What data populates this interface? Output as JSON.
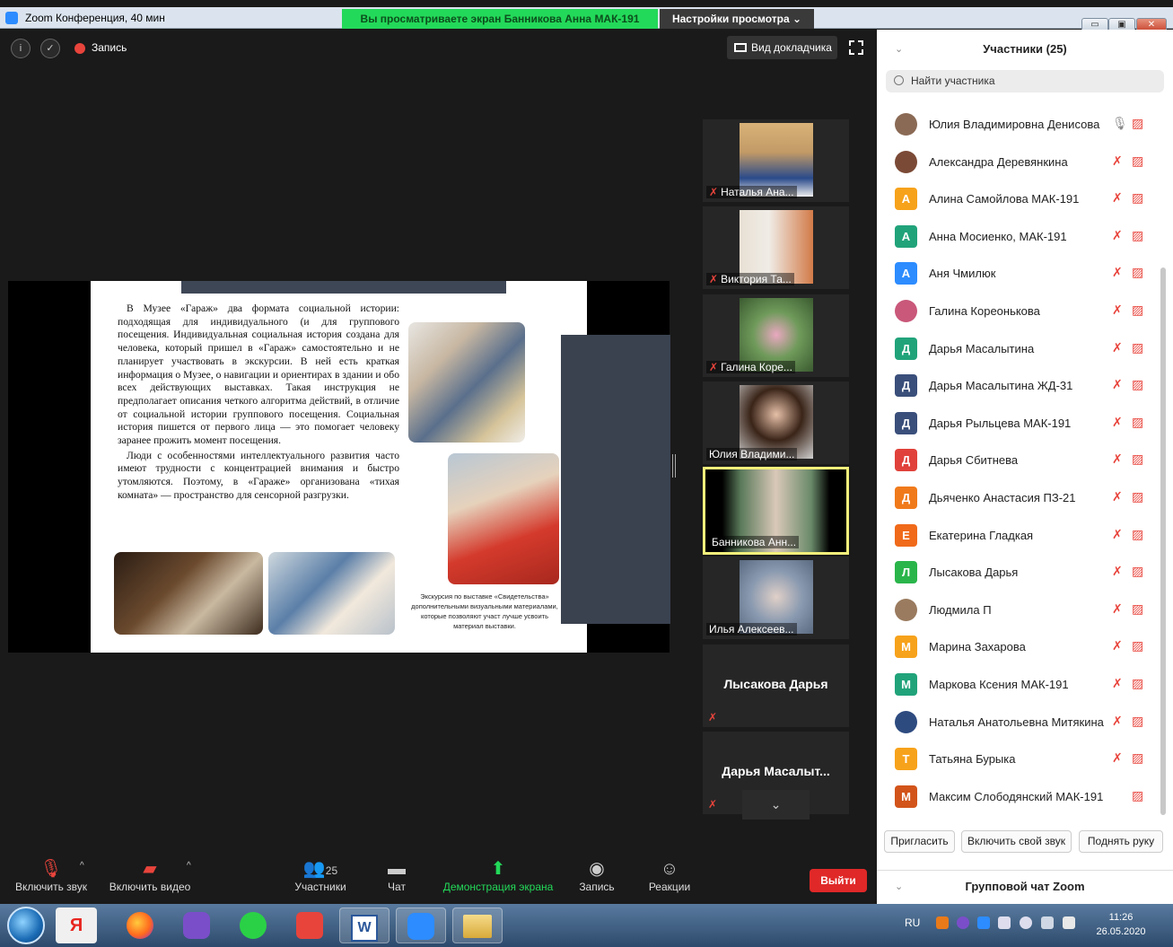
{
  "titlebar": {
    "title": "Zoom Конференция, 40 мин",
    "share_banner": "Вы просматриваете экран  Банникова Анна МАК-191",
    "view_options": "Настройки просмотра ⌄",
    "min": "▭",
    "max": "▣",
    "close": "✕"
  },
  "meeting": {
    "recording_label": "Запись",
    "speaker_view_label": "Вид докладчика"
  },
  "slide": {
    "paragraph1": "В Музее «Гараж» два формата социальной истории: подходящая для индивидуального (и для группового посещения. Индивидуальная социальная история создана для человека, который пришел в «Гараж» самостоятельно и не планирует участвовать в экскурсии. В ней есть краткая информация о Музее, о навигации и ориентирах в здании и обо всех действующих выставках. Такая инструкция не предполагает описания четкого алгоритма действий, в отличие от социальной истории группового посещения. Социальная история пишется от первого лица — это помогает человеку заранее прожить момент посещения.",
    "paragraph2": "Люди с особенностями интеллектуального развития часто имеют трудности с концентрацией внимания и быстро утомляются. Поэтому, в «Гараже» организована «тихая комната» — пространство для сенсорной разгрузки.",
    "caption": "Экскурсия по выставке «Свидетельства» дополнительными визуальными материалами, которые позволяют участ лучше усвоить материал выставки."
  },
  "thumbnails": [
    {
      "name": "Наталья Ана...",
      "muted": true
    },
    {
      "name": "Виктория Та...",
      "muted": true
    },
    {
      "name": "Галина Коре...",
      "muted": true
    },
    {
      "name": "Юлия Владими...",
      "muted": false
    },
    {
      "name": "Банникова Анн...",
      "muted": false,
      "active": true
    },
    {
      "name": "Илья Алексеев...",
      "muted": false
    },
    {
      "name": "Лысакова Дарья",
      "muted": true
    },
    {
      "name": "Дарья  Масалыт...",
      "muted": true
    }
  ],
  "toolbar": {
    "unmute": "Включить звук",
    "start_video": "Включить видео",
    "participants": "Участники",
    "participants_count": "25",
    "chat": "Чат",
    "share_screen": "Демонстрация экрана",
    "record": "Запись",
    "reactions": "Реакции",
    "leave": "Выйти"
  },
  "panel": {
    "title": "Участники (25)",
    "search_placeholder": "Найти участника",
    "invite": "Пригласить",
    "unmute_me": "Включить свой звук",
    "raise_hand": "Поднять руку",
    "chat_title": "Групповой чат Zoom",
    "participants": [
      {
        "name": "Юлия Владимировна Денисова",
        "initial": "",
        "color": "#8a6a55",
        "mic": "on"
      },
      {
        "name": "Александра Деревянкина",
        "initial": "",
        "color": "#7b4a36",
        "mic": "off"
      },
      {
        "name": "Алина Самойлова МАК-191",
        "initial": "А",
        "color": "#f7a21b",
        "mic": "off"
      },
      {
        "name": "Анна Мосиенко, МАК-191",
        "initial": "А",
        "color": "#21a37a",
        "mic": "off"
      },
      {
        "name": "Аня Чмилюк",
        "initial": "А",
        "color": "#2d8cff",
        "mic": "off"
      },
      {
        "name": "Галина Кореонькова",
        "initial": "",
        "color": "#c9587a",
        "mic": "off"
      },
      {
        "name": "Дарья Масалытина",
        "initial": "Д",
        "color": "#21a37a",
        "mic": "off"
      },
      {
        "name": "Дарья Масалытина ЖД-31",
        "initial": "Д",
        "color": "#3a4f7a",
        "mic": "off"
      },
      {
        "name": "Дарья Рыльцева МАК-191",
        "initial": "Д",
        "color": "#3a4f7a",
        "mic": "off"
      },
      {
        "name": "Дарья Сбитнева",
        "initial": "Д",
        "color": "#e0413a",
        "mic": "off"
      },
      {
        "name": "Дьяченко Анастасия ПЗ-21",
        "initial": "Д",
        "color": "#f07a1a",
        "mic": "off"
      },
      {
        "name": "Екатерина Гладкая",
        "initial": "Е",
        "color": "#f06a1a",
        "mic": "off"
      },
      {
        "name": "Лысакова Дарья",
        "initial": "Л",
        "color": "#2ab54a",
        "mic": "off"
      },
      {
        "name": "Людмила П",
        "initial": "",
        "color": "#9a7b5f",
        "mic": "off"
      },
      {
        "name": "Марина Захарова",
        "initial": "М",
        "color": "#f7a21b",
        "mic": "off"
      },
      {
        "name": "Маркова Ксения МАК-191",
        "initial": "М",
        "color": "#21a37a",
        "mic": "off"
      },
      {
        "name": "Наталья Анатольевна Митякина",
        "initial": "",
        "color": "#2e4b80",
        "mic": "off"
      },
      {
        "name": "Татьяна Бурыка",
        "initial": "Т",
        "color": "#f7a21b",
        "mic": "off"
      },
      {
        "name": "Максим Слободянский МАК-191",
        "initial": "М",
        "color": "#d2541a",
        "mic": "none"
      }
    ]
  },
  "taskbar": {
    "lang": "RU",
    "time": "11:26",
    "date": "26.05.2020",
    "yandex_glyph": "Я",
    "word_glyph": "W"
  }
}
